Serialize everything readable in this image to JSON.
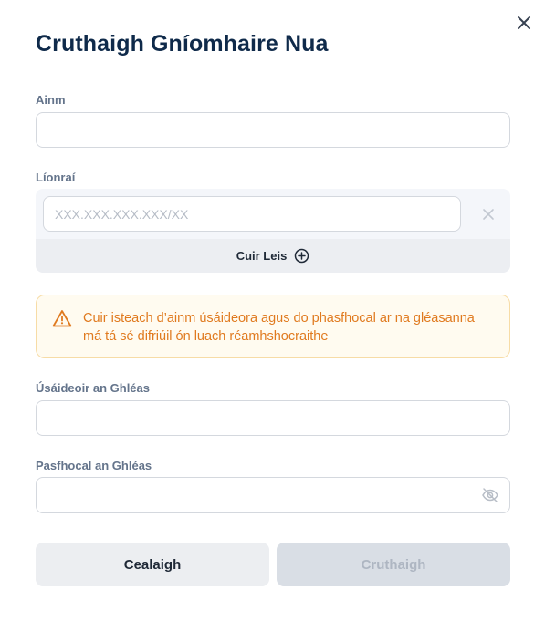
{
  "dialog": {
    "title": "Cruthaigh Gníomhaire Nua",
    "close_icon": "close-icon"
  },
  "fields": {
    "name": {
      "label": "Ainm",
      "value": ""
    },
    "networks": {
      "label": "Líonraí",
      "entries": [
        {
          "value": "",
          "placeholder": "XXX.XXX.XXX.XXX/XX"
        }
      ],
      "remove_icon": "close-icon",
      "add_label": "Cuir Leis",
      "add_icon": "plus-circle-icon"
    },
    "device_user": {
      "label": "Úsáideoir an Ghléas",
      "value": ""
    },
    "device_password": {
      "label": "Pasfhocal an Ghléas",
      "value": "",
      "toggle_icon": "eye-off-icon"
    }
  },
  "warning": {
    "icon": "warning-triangle-icon",
    "text": "Cuir isteach d’ainm úsáideora agus do phasfhocal ar na gléasanna má tá sé difriúil ón luach réamhshocraithe",
    "color": "#e07a1f"
  },
  "actions": {
    "cancel_label": "Cealaigh",
    "create_label": "Cruthaigh",
    "create_enabled": false
  },
  "colors": {
    "title": "#0f2a4a",
    "label": "#64748b",
    "disabled_button_bg": "#d9dee5",
    "disabled_button_text": "#aeb6c2"
  }
}
